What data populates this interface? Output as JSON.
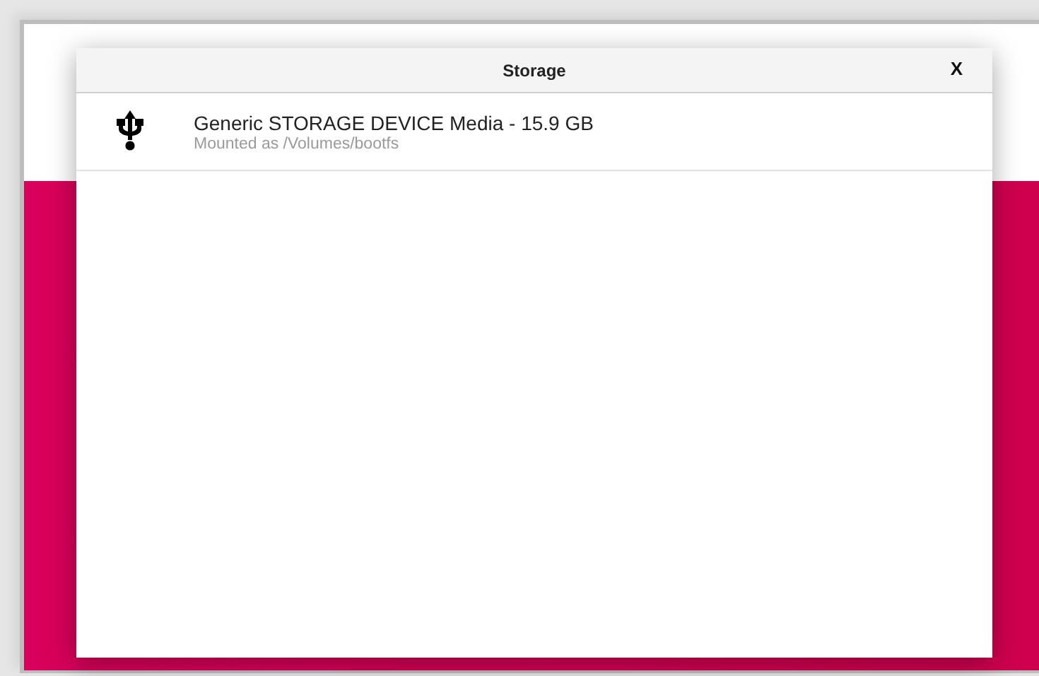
{
  "dialog": {
    "title": "Storage",
    "close": "X"
  },
  "devices": [
    {
      "name": "Generic STORAGE DEVICE Media - 15.9 GB",
      "detail": "Mounted as /Volumes/bootfs"
    }
  ]
}
